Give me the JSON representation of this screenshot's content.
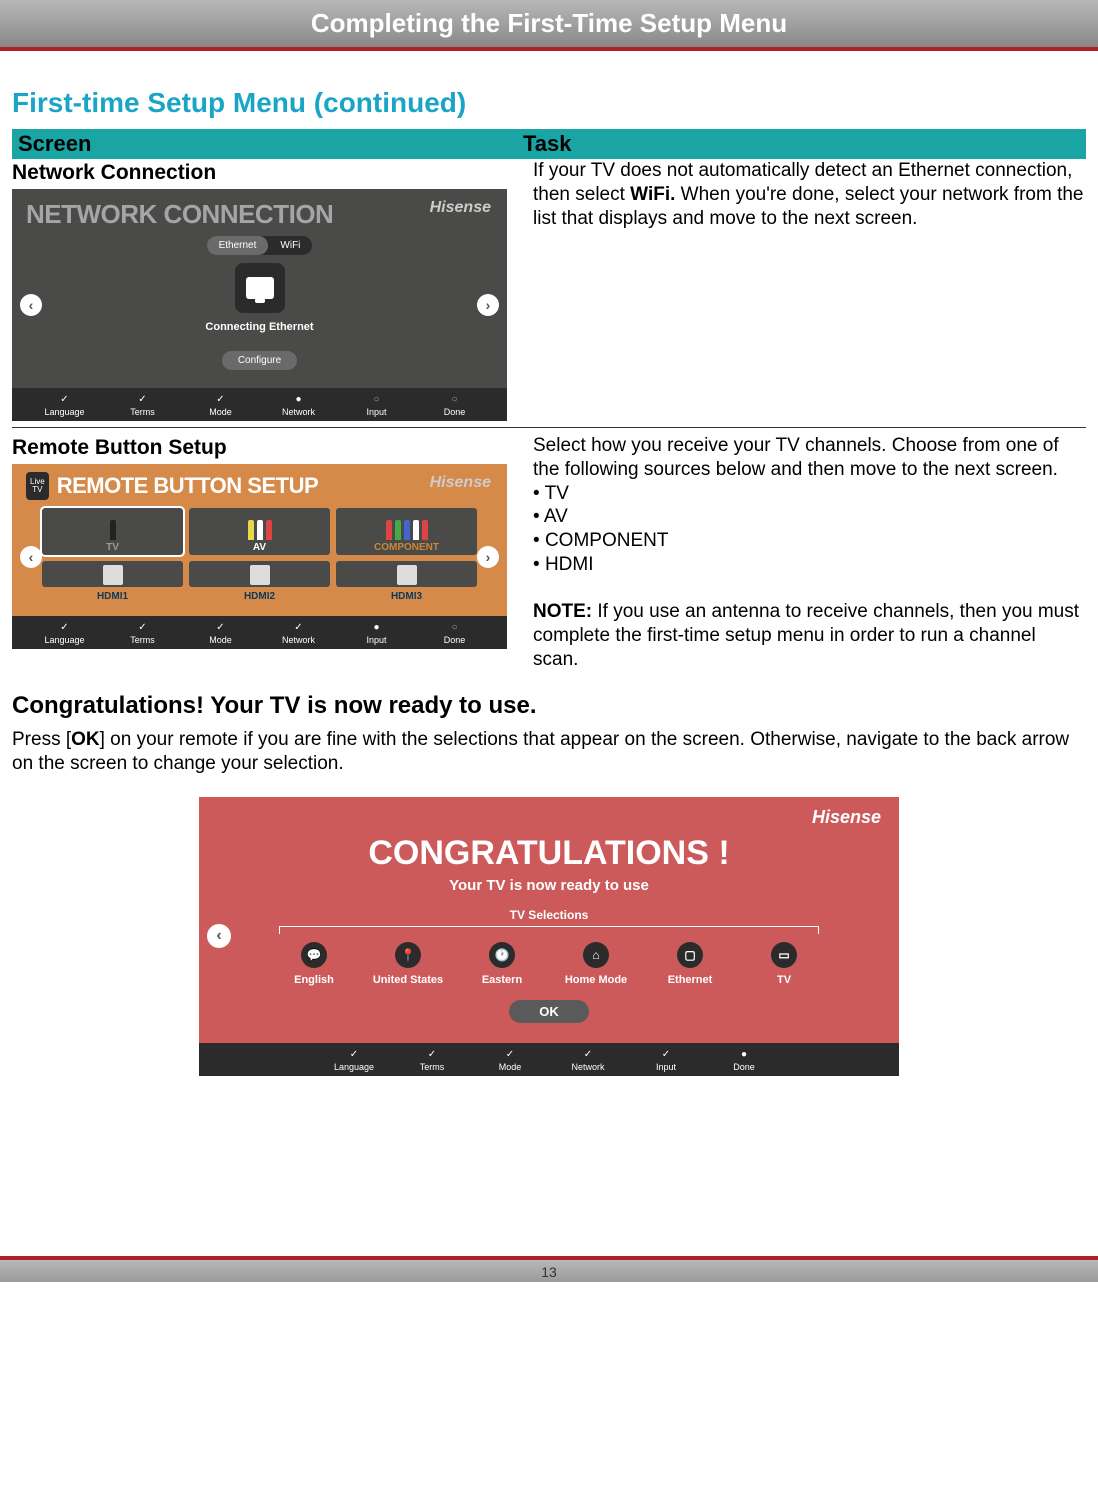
{
  "header": {
    "title": "Completing the First-Time Setup Menu"
  },
  "section_title": "First-time Setup Menu (continued)",
  "table_header": {
    "screen": "Screen",
    "task": "Task"
  },
  "rows": [
    {
      "screen_label": "Network Connection",
      "tv": {
        "title": "NETWORK CONNECTION",
        "brand": "Hisense",
        "toggle": {
          "ethernet": "Ethernet",
          "wifi": "WiFi"
        },
        "status": "Connecting Ethernet",
        "configure": "Configure",
        "steps": [
          "Language",
          "Terms",
          "Mode",
          "Network",
          "Input",
          "Done"
        ],
        "step_states": [
          "check",
          "check",
          "check",
          "dot-filled",
          "dot-empty",
          "dot-empty"
        ]
      },
      "task_pre": "If your TV does not automatically detect an Ethernet connection, then select ",
      "task_bold": "WiFi.",
      "task_post": " When you're done, select your network from the list that displays and move to the next screen."
    },
    {
      "screen_label": "Remote Button Setup",
      "tv": {
        "live": "Live\nTV",
        "title": "REMOTE BUTTON SETUP",
        "brand": "Hisense",
        "sources": [
          "TV",
          "AV",
          "COMPONENT",
          "HDMI1",
          "HDMI2",
          "HDMI3"
        ],
        "steps": [
          "Language",
          "Terms",
          "Mode",
          "Network",
          "Input",
          "Done"
        ],
        "step_states": [
          "check",
          "check",
          "check",
          "check",
          "dot-filled",
          "dot-empty"
        ]
      },
      "task_intro": "Select how you receive your TV channels. Choose from one of the following sources below and then move to the next screen.",
      "bullets": [
        "TV",
        "AV",
        "COMPONENT",
        "HDMI"
      ],
      "note_label": "NOTE:",
      "note_body": " If you use an antenna to receive channels, then you must complete the first-time setup menu in order to run a channel scan."
    }
  ],
  "congrats": {
    "heading": "Congratulations! Your TV is now ready to use.",
    "body_pre": "Press [",
    "body_bold": "OK",
    "body_post": "] on your remote if you are fine with the selections that appear on the screen. Otherwise, navigate to the back arrow on the screen to change your selection.",
    "tv": {
      "brand": "Hisense",
      "title": "CONGRATULATIONS !",
      "sub": "Your TV is now ready to use",
      "selections_label": "TV Selections",
      "items": [
        {
          "label": "English",
          "icon": "…"
        },
        {
          "label": "United States",
          "icon": "📍"
        },
        {
          "label": "Eastern",
          "icon": "🕐"
        },
        {
          "label": "Home Mode",
          "icon": "⌂"
        },
        {
          "label": "Ethernet",
          "icon": "▢"
        },
        {
          "label": "TV",
          "icon": "▭"
        }
      ],
      "ok": "OK",
      "steps": [
        "Language",
        "Terms",
        "Mode",
        "Network",
        "Input",
        "Done"
      ],
      "step_states": [
        "check",
        "check",
        "check",
        "check",
        "check",
        "dot-filled"
      ]
    }
  },
  "page_number": "13"
}
